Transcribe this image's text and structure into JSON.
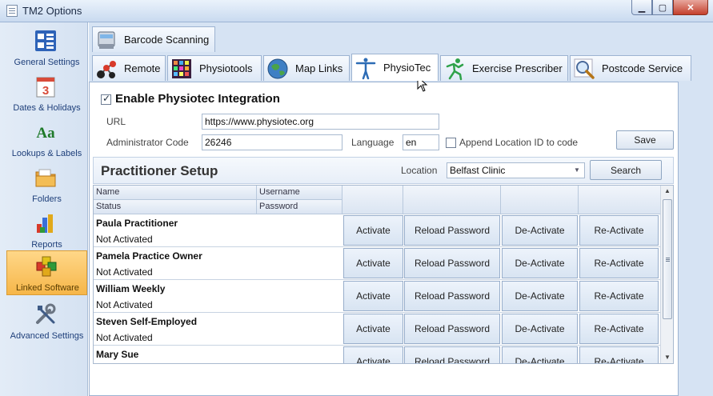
{
  "window": {
    "title": "TM2 Options"
  },
  "sidebar": {
    "items": [
      {
        "label": "General Settings",
        "icon": "general-settings-icon"
      },
      {
        "label": "Dates & Holidays",
        "icon": "calendar-icon"
      },
      {
        "label": "Lookups & Labels",
        "icon": "aa-text-icon"
      },
      {
        "label": "Folders",
        "icon": "folder-icon"
      },
      {
        "label": "Reports",
        "icon": "reports-chart-icon"
      },
      {
        "label": "Linked Software",
        "icon": "cubes-icon",
        "active": true
      },
      {
        "label": "Advanced Settings",
        "icon": "tools-icon"
      }
    ]
  },
  "tabs": {
    "row1": [
      {
        "label": "Barcode Scanning",
        "icon": "scanner-icon"
      }
    ],
    "row2": [
      {
        "label": "Remote",
        "icon": "remote-molecule-icon"
      },
      {
        "label": "Physiotools",
        "icon": "physiotools-grid-icon"
      },
      {
        "label": "Map Links",
        "icon": "globe-icon"
      },
      {
        "label": "PhysioTec",
        "icon": "physiotec-figure-icon",
        "active": true
      },
      {
        "label": "Exercise Prescriber",
        "icon": "exercise-figure-icon"
      },
      {
        "label": "Postcode Service",
        "icon": "magnifier-icon"
      }
    ]
  },
  "physiotec": {
    "enable_label": "Enable Physiotec Integration",
    "enabled": true,
    "url_label": "URL",
    "url_value": "https://www.physiotec.org",
    "admin_code_label": "Administrator Code",
    "admin_code_value": "26246",
    "language_label": "Language",
    "language_value": "en",
    "append_location_label": "Append Location ID to code",
    "append_location_checked": false,
    "save_label": "Save"
  },
  "practitioner_setup": {
    "title": "Practitioner Setup",
    "location_label": "Location",
    "location_value": "Belfast Clinic",
    "search_label": "Search",
    "columns": {
      "name": "Name",
      "username": "Username",
      "status": "Status",
      "password": "Password"
    },
    "actions": [
      "Activate",
      "Reload Password",
      "De-Activate",
      "Re-Activate"
    ],
    "rows": [
      {
        "name": "Paula Practitioner",
        "status": "Not Activated"
      },
      {
        "name": "Pamela Practice Owner",
        "status": "Not Activated"
      },
      {
        "name": "William Weekly",
        "status": "Not Activated"
      },
      {
        "name": "Steven Self-Employed",
        "status": "Not Activated"
      },
      {
        "name": "Mary Sue",
        "status": ""
      }
    ]
  },
  "colors": {
    "sidebar_active": "#f6b649",
    "tab_active": "#ffffff",
    "chrome": "#d6e3f3"
  }
}
